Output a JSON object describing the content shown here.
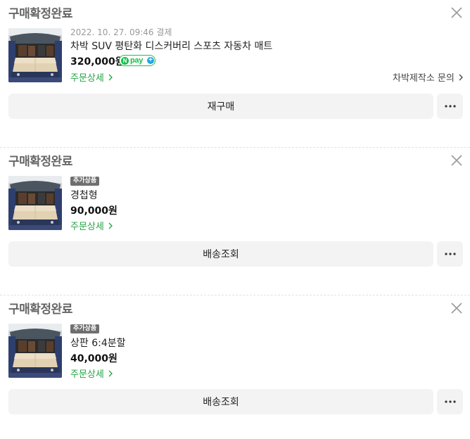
{
  "orders": [
    {
      "status": "구매확정완료",
      "date": "2022. 10. 27. 09:46 결제",
      "product_name": "차박 SUV 평탄화 디스커버리 스포츠 자동차 매트",
      "price": "320,000원",
      "payment_badge": {
        "n": "N",
        "pay": "pay",
        "plus": "+"
      },
      "order_detail_link": "주문상세",
      "seller_inquiry_link": "차박제작소 문의",
      "action_button": "재구매"
    },
    {
      "status": "구매확정완료",
      "badge": "추가상품",
      "product_name": "경첩형",
      "price": "90,000원",
      "order_detail_link": "주문상세",
      "action_button": "배송조회"
    },
    {
      "status": "구매확정완료",
      "badge": "추가상품",
      "product_name": "상판 6:4분할",
      "price": "40,000원",
      "order_detail_link": "주문상세",
      "action_button": "배송조회"
    }
  ],
  "icons": {
    "close": "close-icon",
    "chevron": "chevron-right-icon",
    "more": "more-horizontal-icon",
    "thumbnail": "car-trunk-mat-photo"
  },
  "colors": {
    "status_text": "#666666",
    "link_green": "#21a343",
    "npay_green": "#19c04b",
    "button_bg": "#f3f3f3"
  }
}
